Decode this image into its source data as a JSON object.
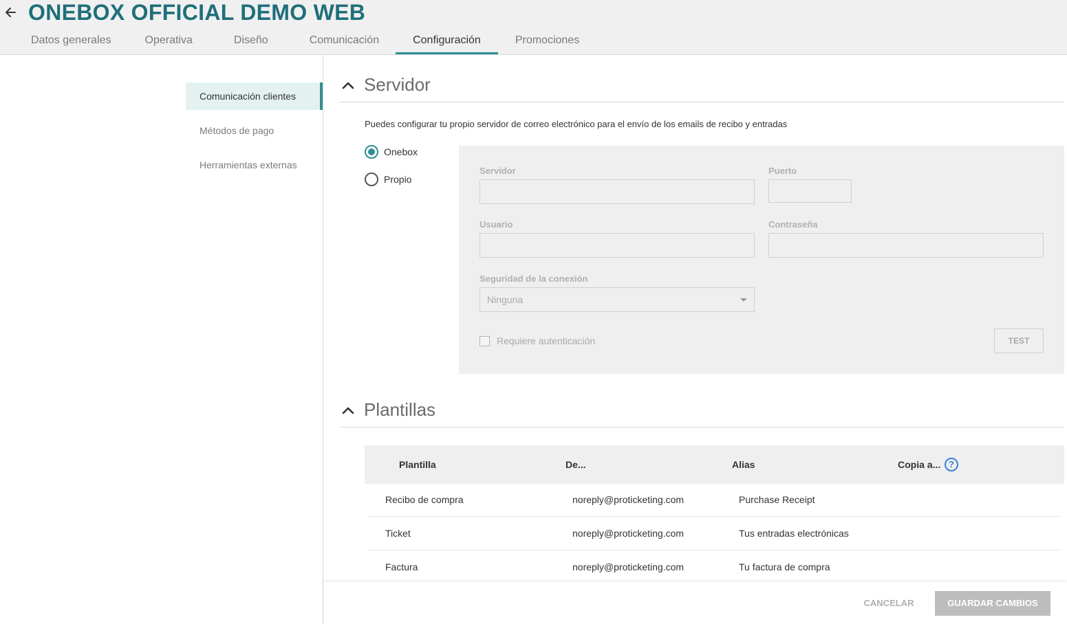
{
  "header": {
    "title": "ONEBOX OFFICIAL DEMO WEB",
    "tabs": [
      {
        "label": "Datos generales"
      },
      {
        "label": "Operativa"
      },
      {
        "label": "Diseño"
      },
      {
        "label": "Comunicación"
      },
      {
        "label": "Configuración",
        "active": true
      },
      {
        "label": "Promociones"
      }
    ]
  },
  "sidebar": {
    "items": [
      {
        "label": "Comunicación clientes",
        "active": true
      },
      {
        "label": "Métodos de pago"
      },
      {
        "label": "Herramientas externas"
      }
    ]
  },
  "servidor": {
    "title": "Servidor",
    "description": "Puedes configurar tu propio servidor de correo electrónico para el envío de los emails de recibo y entradas",
    "options": [
      {
        "label": "Onebox",
        "checked": true
      },
      {
        "label": "Propio",
        "checked": false
      }
    ],
    "fields": {
      "servidor_label": "Servidor",
      "servidor_value": "",
      "puerto_label": "Puerto",
      "puerto_value": "",
      "usuario_label": "Usuario",
      "usuario_value": "",
      "contrasena_label": "Contraseña",
      "contrasena_value": "",
      "seguridad_label": "Seguridad de la conexión",
      "seguridad_value": "Ninguna"
    },
    "requiere_autenticacion_label": "Requiere autenticación",
    "test_label": "TEST"
  },
  "plantillas": {
    "title": "Plantillas",
    "columns": [
      "Plantilla",
      "De...",
      "Alias",
      "Copia a..."
    ],
    "rows": [
      {
        "plantilla": "Recibo de compra",
        "de": "noreply@proticketing.com",
        "alias": "Purchase Receipt",
        "copia": ""
      },
      {
        "plantilla": "Ticket",
        "de": "noreply@proticketing.com",
        "alias": "Tus entradas electrónicas",
        "copia": ""
      },
      {
        "plantilla": "Factura",
        "de": "noreply@proticketing.com",
        "alias": "Tu factura de compra",
        "copia": ""
      }
    ]
  },
  "footer": {
    "cancel_label": "CANCELAR",
    "save_label": "GUARDAR CAMBIOS"
  },
  "colors": {
    "accent": "#2f8f93",
    "title": "#1f6f7a",
    "help": "#3b7fd8"
  },
  "icons": {
    "back": "arrow-left-icon",
    "collapse": "chevron-up-icon",
    "dropdown": "caret-down-icon",
    "help": "help-circle-icon"
  }
}
